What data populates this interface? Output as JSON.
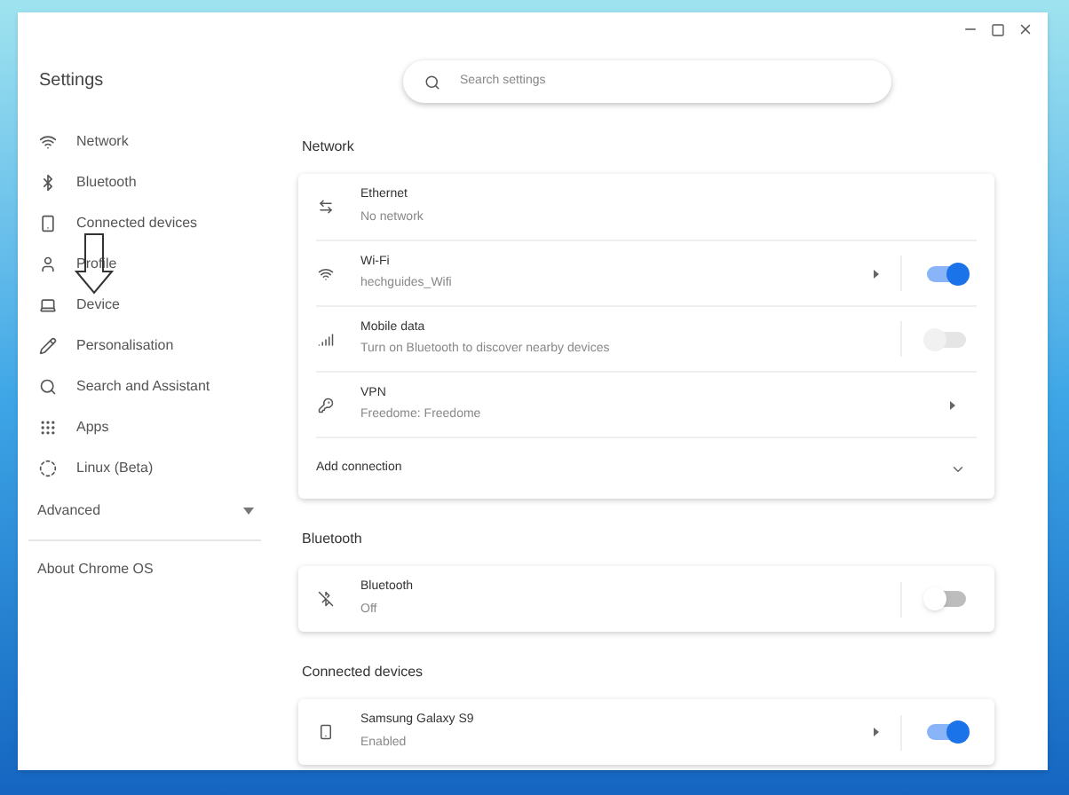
{
  "title": "Settings",
  "search": {
    "placeholder": "Search settings"
  },
  "sidebar": {
    "items": [
      {
        "label": "Network"
      },
      {
        "label": "Bluetooth"
      },
      {
        "label": "Connected devices"
      },
      {
        "label": "Profile"
      },
      {
        "label": "Device"
      },
      {
        "label": "Personalisation"
      },
      {
        "label": "Search and Assistant"
      },
      {
        "label": "Apps"
      },
      {
        "label": "Linux (Beta)"
      }
    ],
    "advanced": {
      "label": "Advanced",
      "expanded": false
    },
    "about": "About Chrome OS"
  },
  "sections": [
    {
      "title": "Network",
      "rows": [
        {
          "title": "Ethernet",
          "subtitle": "No network",
          "arrow": false
        },
        {
          "title": "Wi-Fi",
          "subtitle": "hechguides_Wifi",
          "arrow": true,
          "toggle": {
            "on": true,
            "disabled": false
          }
        },
        {
          "title": "Mobile data",
          "subtitle": "Turn on Bluetooth to discover nearby devices",
          "arrow": false,
          "toggle": {
            "on": false,
            "disabled": true
          }
        },
        {
          "title": "VPN",
          "subtitle": "Freedome: Freedome",
          "arrow": true
        }
      ],
      "footer": {
        "label": "Add connection",
        "expanded": false
      }
    },
    {
      "title": "Bluetooth",
      "rows": [
        {
          "title": "Bluetooth",
          "subtitle": "Off",
          "arrow": false,
          "toggle": {
            "on": false,
            "disabled": false
          }
        }
      ]
    },
    {
      "title": "Connected devices",
      "rows": [
        {
          "title": "Samsung Galaxy S9",
          "subtitle": "Enabled",
          "arrow": true,
          "toggle": {
            "on": true,
            "disabled": false
          }
        }
      ]
    }
  ]
}
